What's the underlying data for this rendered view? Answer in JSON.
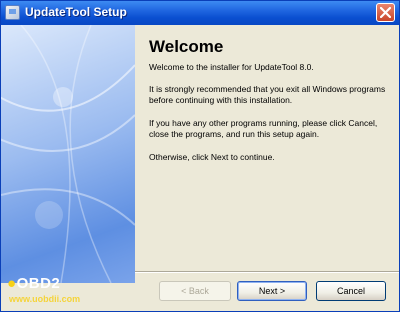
{
  "window": {
    "title": "UpdateTool Setup"
  },
  "content": {
    "heading": "Welcome",
    "paragraphs": [
      "Welcome to the installer for UpdateTool 8.0.",
      "It is strongly recommended that you exit all Windows programs before continuing with this installation.",
      "If you have any other programs running, please click Cancel, close the programs, and run this setup again.",
      "Otherwise, click Next to continue."
    ]
  },
  "buttons": {
    "back": "< Back",
    "next": "Next >",
    "cancel": "Cancel"
  },
  "watermark": {
    "brand": "OBD2",
    "url": "www.uobdii.com"
  },
  "colors": {
    "titlebar": "#0a4fd0",
    "panel": "#5e8fe2",
    "background": "#ece9d8"
  }
}
